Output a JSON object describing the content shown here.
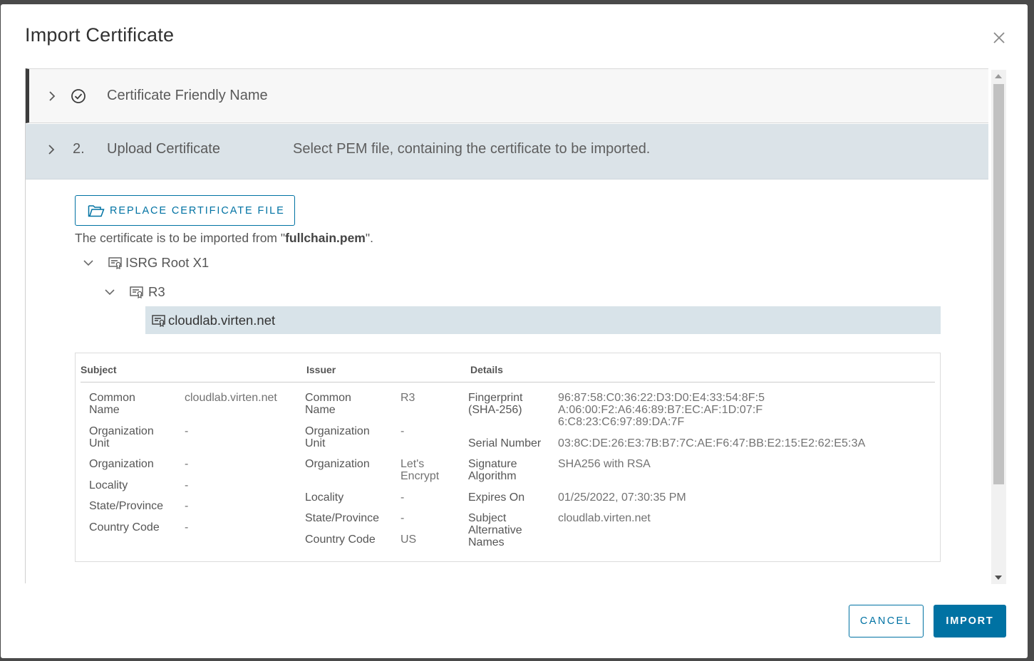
{
  "dialog": {
    "title": "Import Certificate"
  },
  "steps": [
    {
      "number": "",
      "title": "Certificate Friendly Name",
      "description": "",
      "status_icon": "check-circle-icon"
    },
    {
      "number": "2.",
      "title": "Upload Certificate",
      "description": "Select PEM file, containing the certificate to be imported."
    }
  ],
  "upload": {
    "replace_button_label": "REPLACE CERTIFICATE FILE",
    "note_prefix": "The certificate is to be imported from \"",
    "file_name": "fullchain.pem",
    "note_suffix": "\"."
  },
  "tree": {
    "root": "ISRG Root X1",
    "intermediate": "R3",
    "leaf": "cloudlab.virten.net"
  },
  "details": {
    "headers": {
      "subject": "Subject",
      "issuer": "Issuer",
      "details": "Details"
    },
    "subject": {
      "common_name_label": "Common Name",
      "common_name": "cloudlab.virten.net",
      "org_unit_label": "Organization Unit",
      "org_unit": "-",
      "organization_label": "Organization",
      "organization": "-",
      "locality_label": "Locality",
      "locality": "-",
      "state_label": "State/Province",
      "state": "-",
      "country_label": "Country Code",
      "country": "-"
    },
    "issuer": {
      "common_name_label": "Common Name",
      "common_name": "R3",
      "org_unit_label": "Organization Unit",
      "org_unit": "-",
      "organization_label": "Organization",
      "organization": "Let's Encrypt",
      "locality_label": "Locality",
      "locality": "-",
      "state_label": "State/Province",
      "state": "-",
      "country_label": "Country Code",
      "country": "US"
    },
    "info": {
      "fingerprint_label": "Fingerprint (SHA-256)",
      "fingerprint_line1": "96:87:58:C0:36:22:D3:D0:E4:33:54:8F:5",
      "fingerprint_line2": "A:06:00:F2:A6:46:89:B7:EC:AF:1D:07:F",
      "fingerprint_line3": "6:C8:23:C6:97:89:DA:7F",
      "serial_label": "Serial Number",
      "serial": "03:8C:DE:26:E3:7B:B7:7C:AE:F6:47:BB:E2:15:E2:62:E5:3A",
      "sig_label": "Signature Algorithm",
      "sig": "SHA256 with RSA",
      "expires_label": "Expires On",
      "expires": "01/25/2022, 07:30:35 PM",
      "san_label": "Subject Alternative Names",
      "san": "cloudlab.virten.net"
    }
  },
  "footer": {
    "cancel_label": "CANCEL",
    "import_label": "IMPORT"
  },
  "colors": {
    "accent": "#0072a3",
    "selected_bg": "#d8e3e9",
    "active_step_bg": "#dbe3e8"
  }
}
